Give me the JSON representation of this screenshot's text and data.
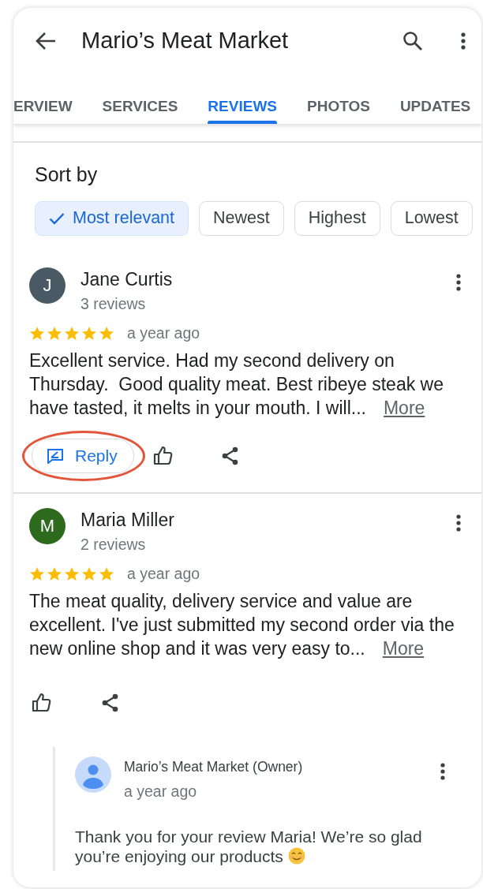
{
  "app_bar": {
    "title": "Mario’s Meat Market"
  },
  "tabs": [
    {
      "label": "ERVIEW",
      "selected": false
    },
    {
      "label": "SERVICES",
      "selected": false
    },
    {
      "label": "REVIEWS",
      "selected": true
    },
    {
      "label": "PHOTOS",
      "selected": false
    },
    {
      "label": "UPDATES",
      "selected": false
    }
  ],
  "sort": {
    "label": "Sort by",
    "options": [
      {
        "label": "Most relevant",
        "selected": true
      },
      {
        "label": "Newest",
        "selected": false
      },
      {
        "label": "Highest",
        "selected": false
      },
      {
        "label": "Lowest",
        "selected": false
      }
    ]
  },
  "reviews": [
    {
      "author": "Jane Curtis",
      "initial": "J",
      "color": "#4a5a65",
      "review_count": "3 reviews",
      "stars": 5,
      "time": "a year ago",
      "text": "Excellent service. Had my second delivery on Thursday.  Good quality meat. Best ribeye steak we have tasted, it melts in your mouth. I will...",
      "more": "More",
      "reply_button": {
        "label": "Reply",
        "circled": true
      }
    },
    {
      "author": "Maria Miller",
      "initial": "M",
      "color": "#2e6a1e",
      "review_count": "2 reviews",
      "stars": 5,
      "time": "a year ago",
      "text": "The meat quality, delivery service and value are excellent. I've just submitted my second order via the new online shop and it was very easy to...",
      "more": "More",
      "owner_reply": {
        "author": "Mario’s Meat Market (Owner)",
        "time": "a year ago",
        "text": "Thank you for your review Maria! We’re so glad you’re enjoying our products"
      }
    }
  ]
}
